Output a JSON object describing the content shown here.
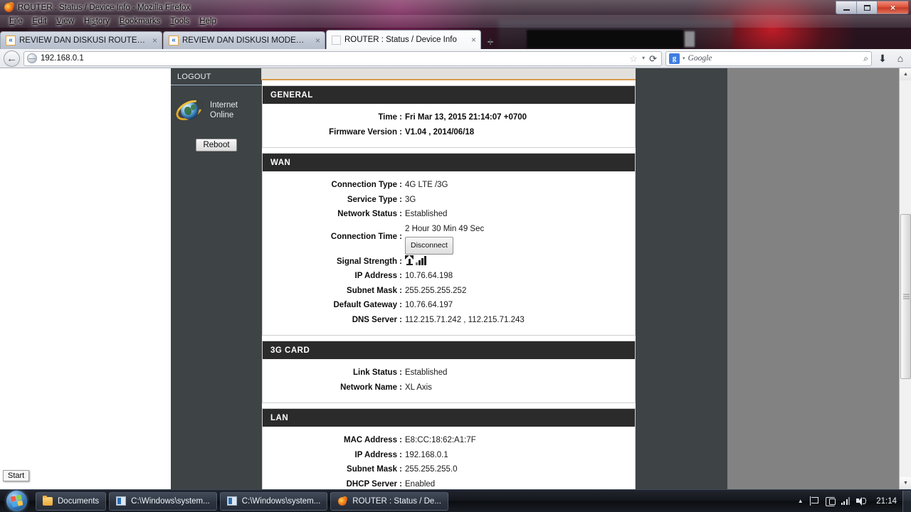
{
  "window": {
    "title": "ROUTER : Status / Device Info - Mozilla Firefox",
    "app_icon": "firefox-icon",
    "controls": {
      "minimize": "minimize-icon",
      "restore": "restore-icon",
      "close": "×"
    }
  },
  "menubar": {
    "items": [
      {
        "label": "File"
      },
      {
        "label": "Edit"
      },
      {
        "label": "View"
      },
      {
        "label": "History"
      },
      {
        "label": "Bookmarks"
      },
      {
        "label": "Tools"
      },
      {
        "label": "Help"
      }
    ]
  },
  "tabs": [
    {
      "label": "REVIEW DAN DISKUSI ROUTER 3G/4G ...",
      "favicon": "kaskus-icon",
      "close": "×",
      "active": false
    },
    {
      "label": "REVIEW DAN DISKUSI MODEM ZTE M...",
      "favicon": "kaskus-icon",
      "close": "×",
      "active": false
    },
    {
      "label": "ROUTER : Status / Device Info",
      "favicon": "blank-page-icon",
      "close": "×",
      "active": true
    }
  ],
  "newtab_label": "+",
  "navbar": {
    "back_glyph": "←",
    "site_icon": "globe-icon",
    "url": "192.168.0.1",
    "star_glyph": "☆",
    "caret_glyph": "▾",
    "reload_glyph": "⟳",
    "search": {
      "engine_letter": "g",
      "caret_glyph": "▾",
      "placeholder": "Google",
      "magnifier_glyph": "⌕"
    },
    "download_glyph": "⬇",
    "home_glyph": "⌂"
  },
  "sidebar": {
    "logout_label": "LOGOUT",
    "status_icon": "internet-globe-icon",
    "status_line1": "Internet",
    "status_line2": "Online",
    "reboot_label": "Reboot"
  },
  "panels": [
    {
      "title": "GENERAL",
      "rows": [
        {
          "label": "Time :",
          "value": "Fri Mar 13, 2015 21:14:07 +0700",
          "bold_value": true
        },
        {
          "label": "Firmware Version :",
          "value": "V1.04 , 2014/06/18",
          "bold_value": true
        }
      ]
    },
    {
      "title": "WAN",
      "rows": [
        {
          "label": "Connection Type :",
          "value": "4G LTE /3G"
        },
        {
          "label": "Service Type :",
          "value": "3G"
        },
        {
          "label": "Network Status :",
          "value": "Established"
        },
        {
          "label": "Connection Time :",
          "value": "2 Hour 30 Min 49 Sec",
          "button": "Disconnect"
        },
        {
          "label": "Signal Strength :",
          "value": "",
          "icon": "signal-strength-icon"
        },
        {
          "label": "IP Address :",
          "value": "10.76.64.198"
        },
        {
          "label": "Subnet Mask :",
          "value": "255.255.255.252"
        },
        {
          "label": "Default Gateway :",
          "value": "10.76.64.197"
        },
        {
          "label": "DNS Server :",
          "value": "112.215.71.242 , 112.215.71.243"
        }
      ]
    },
    {
      "title": "3G CARD",
      "rows": [
        {
          "label": "Link Status :",
          "value": "Established"
        },
        {
          "label": "Network Name :",
          "value": "XL Axis"
        }
      ]
    },
    {
      "title": "LAN",
      "rows": [
        {
          "label": "MAC Address :",
          "value": "E8:CC:18:62:A1:7F"
        },
        {
          "label": "IP Address :",
          "value": "192.168.0.1"
        },
        {
          "label": "Subnet Mask :",
          "value": "255.255.255.0"
        },
        {
          "label": "DHCP Server :",
          "value": "Enabled"
        }
      ]
    }
  ],
  "scrollbar": {
    "up_glyph": "▲",
    "down_glyph": "▼"
  },
  "desktop": {
    "start_tooltip": "Start"
  },
  "taskbar": {
    "start_icon": "windows-orb-icon",
    "buttons": [
      {
        "label": "Documents",
        "icon": "folder-icon"
      },
      {
        "label": "C:\\Windows\\system...",
        "icon": "command-prompt-icon"
      },
      {
        "label": "C:\\Windows\\system...",
        "icon": "command-prompt-icon"
      },
      {
        "label": "ROUTER : Status / De...",
        "icon": "firefox-icon"
      }
    ],
    "tray": {
      "chevron": "▲",
      "icons": [
        "flag-icon",
        "action-center-icon",
        "network-signal-icon",
        "speaker-icon"
      ],
      "clock": "21:14"
    }
  },
  "colors": {
    "panel_header_bg": "#2b2b2b",
    "sidebar_bg": "#3e4345",
    "page_bg": "#828282",
    "accent_orange": "#d79b4a",
    "close_red": "#d94d36"
  }
}
